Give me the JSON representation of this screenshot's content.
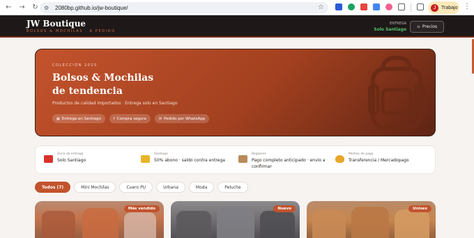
{
  "browser": {
    "url": "2080bp.github.io/jw-boutique/",
    "profile_initial": "J",
    "profile_label": "Trabajo"
  },
  "header": {
    "brand": "JW Boutique",
    "subtitle": "BOLSOS & MOCHILAS · A PEDIDO",
    "delivery_label": "ENTREGA",
    "delivery_value": "Solo Santiago",
    "prices_button": "Precios"
  },
  "hero": {
    "tag": "COLECCIÓN 2025",
    "title_line1": "Bolsos & Mochilas",
    "title_line2": "de tendencia",
    "description": "Productos de calidad importados · Entrega solo en Santiago",
    "chips": [
      {
        "icon": "calendar-icon",
        "label": "Entrega en Santiago"
      },
      {
        "icon": "facebook-icon",
        "label": "Compra segura"
      },
      {
        "icon": "message-icon",
        "label": "Pedido por WhatsApp"
      }
    ]
  },
  "info": [
    {
      "icon": "truck-icon",
      "label": "Zona de entrega",
      "value": "Solo Santiago"
    },
    {
      "icon": "card-icon",
      "label": "Santiago",
      "value": "50% abono · saldo contra entrega"
    },
    {
      "icon": "box-icon",
      "label": "Regiones",
      "value_line1": "Pago completo anticipado · envío a",
      "value_line2": "confirmar"
    },
    {
      "icon": "moneybag-icon",
      "label": "Medios de pago",
      "value": "Transferencia / Mercadopago"
    }
  ],
  "filters": [
    "Todos (7)",
    "Mini Mochilas",
    "Cuero PU",
    "Urbana",
    "Moda",
    "Peluche"
  ],
  "products": [
    {
      "badge": "Más vendido"
    },
    {
      "badge": "Nuevo"
    },
    {
      "badge": "Unisex"
    }
  ],
  "colors": {
    "accent": "#c2532d",
    "header_bg": "#1e1818",
    "delivery_green": "#4fc46a"
  }
}
